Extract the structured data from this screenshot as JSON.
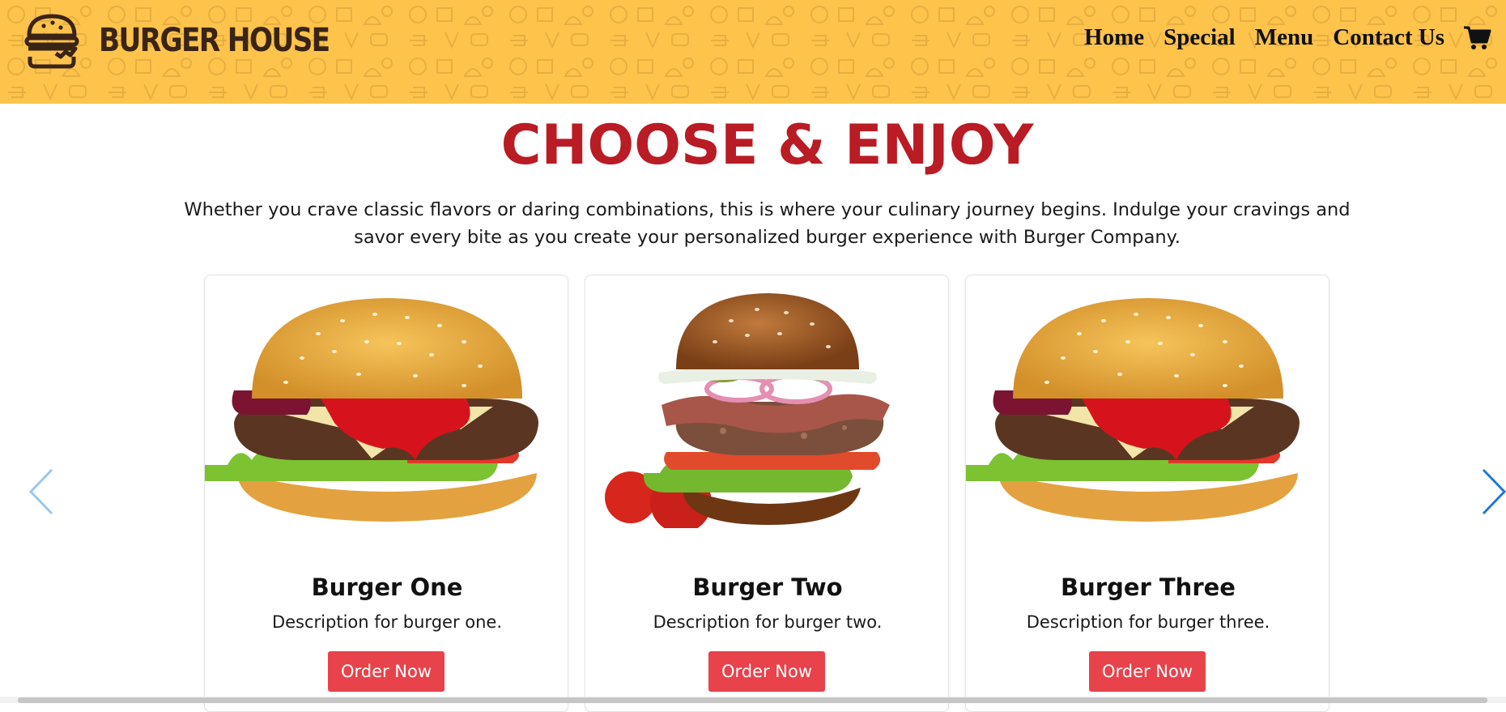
{
  "header": {
    "brand": "BURGER HOUSE",
    "nav": [
      "Home",
      "Special",
      "Menu",
      "Contact Us"
    ],
    "background_color": "#fdc34b"
  },
  "hero": {
    "title": "CHOOSE & ENJOY",
    "intro": "Whether you crave classic flavors or daring combinations, this is where your culinary journey begins. Indulge your cravings and savor every bite as you create your personalized burger experience with Burger Company.",
    "title_color": "#b91c24"
  },
  "cards": [
    {
      "name": "Burger One",
      "description": "Description for burger one.",
      "button": "Order Now"
    },
    {
      "name": "Burger Two",
      "description": "Description for burger two.",
      "button": "Order Now"
    },
    {
      "name": "Burger Three",
      "description": "Description for burger three.",
      "button": "Order Now"
    }
  ],
  "colors": {
    "button": "#e8424b",
    "arrow_prev": "#9cc6ef",
    "arrow_next": "#1e78d4"
  },
  "icons": {
    "logo": "burger-logo-icon",
    "cart": "cart-icon",
    "prev": "chevron-left-icon",
    "next": "chevron-right-icon"
  }
}
